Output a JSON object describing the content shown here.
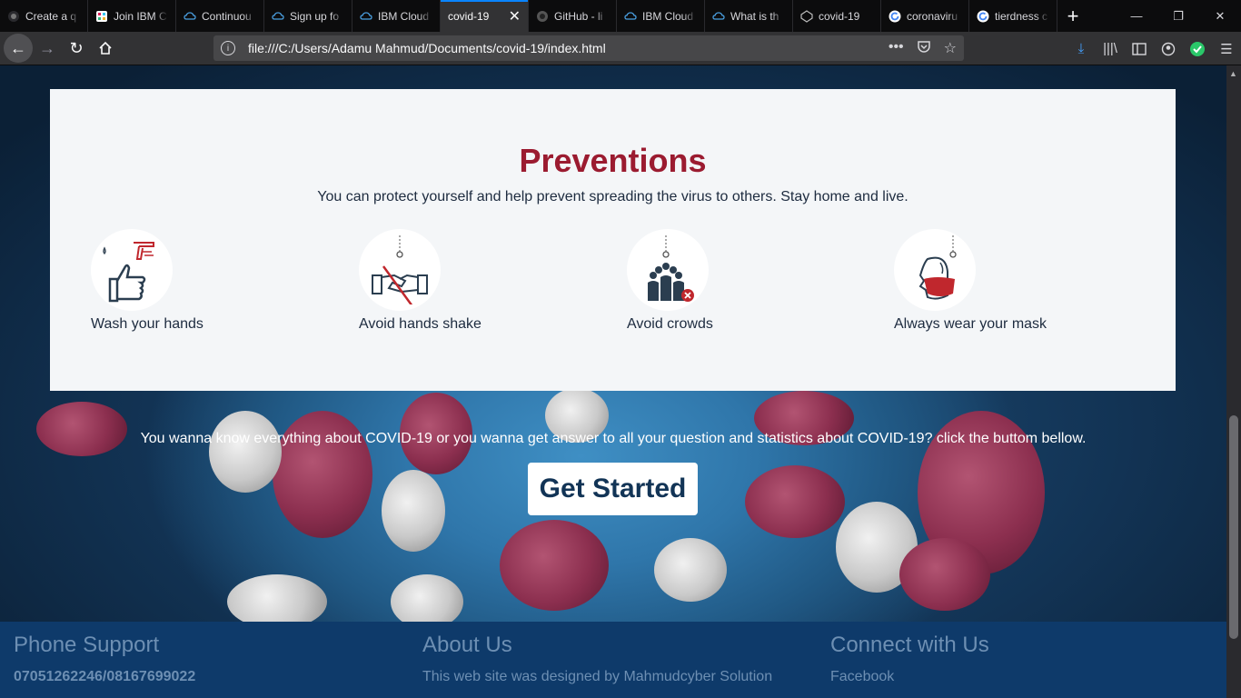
{
  "browser": {
    "tabs": [
      {
        "label": "Create a q",
        "favicon": "github-icon",
        "active": false
      },
      {
        "label": "Join IBM C",
        "favicon": "slack-icon",
        "active": false
      },
      {
        "label": "Continuou",
        "favicon": "ibm-cloud-icon",
        "active": false
      },
      {
        "label": "Sign up fo",
        "favicon": "ibm-cloud-icon",
        "active": false
      },
      {
        "label": "IBM Cloud",
        "favicon": "ibm-cloud-icon",
        "active": false
      },
      {
        "label": "covid-19",
        "favicon": "",
        "active": true
      },
      {
        "label": "GitHub - li",
        "favicon": "github-icon",
        "active": false
      },
      {
        "label": "IBM Cloud",
        "favicon": "ibm-cloud-icon",
        "active": false
      },
      {
        "label": "What is th",
        "favicon": "ibm-cloud-icon",
        "active": false
      },
      {
        "label": "covid-19",
        "favicon": "codepen-icon",
        "active": false
      },
      {
        "label": "coronaviru",
        "favicon": "google-icon",
        "active": false
      },
      {
        "label": "tierdness c",
        "favicon": "google-icon",
        "active": false
      }
    ],
    "new_tab": "+",
    "url": "file:///C:/Users/Adamu Mahmud/Documents/covid-19/index.html"
  },
  "preventions": {
    "title": "Preventions",
    "subtitle": "You can protect yourself and help prevent spreading the virus to others. Stay home and live.",
    "items": [
      {
        "label": "Wash your hands",
        "icon": "hand-wash-icon"
      },
      {
        "label": "Avoid hands shake",
        "icon": "no-handshake-icon"
      },
      {
        "label": "Avoid crowds",
        "icon": "crowd-icon"
      },
      {
        "label": "Always wear your mask",
        "icon": "face-mask-icon"
      }
    ]
  },
  "cta": {
    "text": "You wanna know everything about COVID-19 or you wanna get answer to all your question and statistics about COVID-19? click the buttom bellow.",
    "button": "Get Started"
  },
  "footer": {
    "phone": {
      "heading": "Phone Support",
      "number": "07051262246/08167699022"
    },
    "about": {
      "heading": "About Us",
      "line1": "This web site was designed by Mahmudcyber Solution"
    },
    "connect": {
      "heading": "Connect with Us",
      "link1": "Facebook"
    }
  },
  "colors": {
    "title_red": "#9b1b30",
    "accent_blue": "#0a84ff",
    "footer_bg": "#0e3a6a",
    "button_text": "#123456"
  }
}
